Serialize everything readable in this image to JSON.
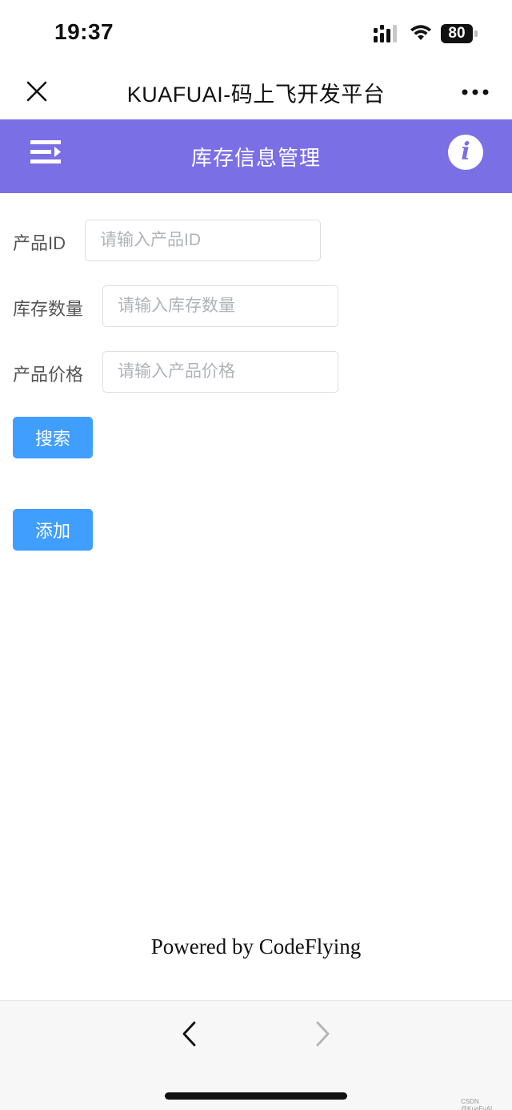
{
  "status_bar": {
    "time": "19:37",
    "battery": "80"
  },
  "browser": {
    "title": "KUAFUAI-码上飞开发平台"
  },
  "header": {
    "title": "库存信息管理",
    "info_glyph": "i"
  },
  "form": {
    "product_id": {
      "label": "产品ID",
      "placeholder": "请输入产品ID",
      "value": ""
    },
    "stock_qty": {
      "label": "库存数量",
      "placeholder": "请输入库存数量",
      "value": ""
    },
    "price": {
      "label": "产品价格",
      "placeholder": "请输入产品价格",
      "value": ""
    }
  },
  "buttons": {
    "search": "搜索",
    "add": "添加"
  },
  "footer": {
    "powered_by": "Powered by CodeFlying"
  },
  "watermark": "CSDN @KuaFuAI",
  "colors": {
    "header_bg": "#7b6fe6",
    "button_bg": "#409eff"
  },
  "icons": [
    "close-icon",
    "more-icon",
    "menu-icon",
    "info-icon",
    "back-arrow-icon",
    "forward-arrow-icon"
  ]
}
